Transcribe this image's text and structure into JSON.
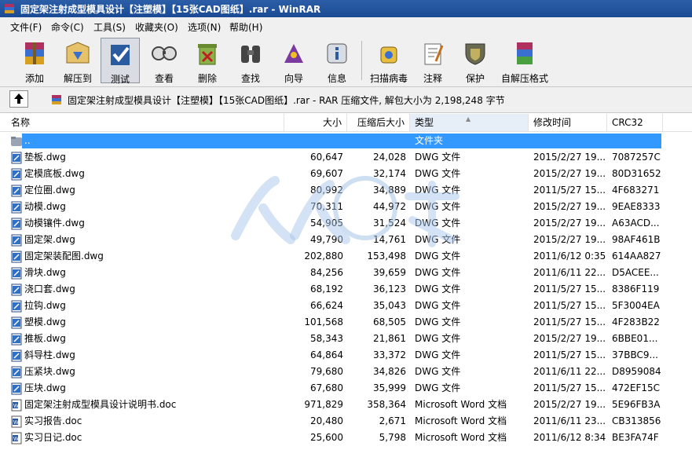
{
  "window": {
    "title": "固定架注射成型模具设计【注塑模】【15张CAD图纸】.rar - WinRAR"
  },
  "menu": [
    {
      "label": "文件(F)"
    },
    {
      "label": "命令(C)"
    },
    {
      "label": "工具(S)"
    },
    {
      "label": "收藏夹(O)"
    },
    {
      "label": "选项(N)"
    },
    {
      "label": "帮助(H)"
    }
  ],
  "toolbar": [
    {
      "label": "添加",
      "icon": "add-icon"
    },
    {
      "label": "解压到",
      "icon": "extract-icon"
    },
    {
      "label": "测试",
      "icon": "test-icon"
    },
    {
      "label": "查看",
      "icon": "view-icon"
    },
    {
      "label": "删除",
      "icon": "delete-icon"
    },
    {
      "label": "查找",
      "icon": "find-icon"
    },
    {
      "label": "向导",
      "icon": "wizard-icon"
    },
    {
      "label": "信息",
      "icon": "info-icon"
    },
    {
      "label": "扫描病毒",
      "icon": "virus-scan-icon"
    },
    {
      "label": "注释",
      "icon": "comment-icon"
    },
    {
      "label": "保护",
      "icon": "protect-icon"
    },
    {
      "label": "自解压格式",
      "icon": "sfx-icon"
    }
  ],
  "pathbar": {
    "text": "固定架注射成型模具设计【注塑模】【15张CAD图纸】.rar - RAR 压缩文件, 解包大小为 2,198,248 字节"
  },
  "columns": [
    {
      "label": "名称"
    },
    {
      "label": "大小"
    },
    {
      "label": "压缩后大小"
    },
    {
      "label": "类型"
    },
    {
      "label": "修改时间"
    },
    {
      "label": "CRC32"
    }
  ],
  "files": [
    {
      "name": "..",
      "size": "",
      "packed": "",
      "type": "文件夹",
      "modified": "",
      "crc": "",
      "kind": "folder"
    },
    {
      "name": "垫板.dwg",
      "size": "60,647",
      "packed": "24,028",
      "type": "DWG 文件",
      "modified": "2015/2/27 19...",
      "crc": "7087257C",
      "kind": "dwg"
    },
    {
      "name": "定模底板.dwg",
      "size": "69,607",
      "packed": "32,174",
      "type": "DWG 文件",
      "modified": "2015/2/27 19...",
      "crc": "80D31652",
      "kind": "dwg"
    },
    {
      "name": "定位圈.dwg",
      "size": "80,992",
      "packed": "34,889",
      "type": "DWG 文件",
      "modified": "2011/5/27 15...",
      "crc": "4F683271",
      "kind": "dwg"
    },
    {
      "name": "动模.dwg",
      "size": "70,311",
      "packed": "44,972",
      "type": "DWG 文件",
      "modified": "2015/2/27 19...",
      "crc": "9EAE8333",
      "kind": "dwg"
    },
    {
      "name": "动模镶件.dwg",
      "size": "54,905",
      "packed": "31,524",
      "type": "DWG 文件",
      "modified": "2015/2/27 19...",
      "crc": "A63ACD...",
      "kind": "dwg"
    },
    {
      "name": "固定架.dwg",
      "size": "49,790",
      "packed": "14,761",
      "type": "DWG 文件",
      "modified": "2015/2/27 19...",
      "crc": "98AF461B",
      "kind": "dwg"
    },
    {
      "name": "固定架装配图.dwg",
      "size": "202,880",
      "packed": "153,498",
      "type": "DWG 文件",
      "modified": "2011/6/12 0:35",
      "crc": "614AA827",
      "kind": "dwg"
    },
    {
      "name": "滑块.dwg",
      "size": "84,256",
      "packed": "39,659",
      "type": "DWG 文件",
      "modified": "2011/6/11 22...",
      "crc": "D5ACEE...",
      "kind": "dwg"
    },
    {
      "name": "浇口套.dwg",
      "size": "68,192",
      "packed": "36,123",
      "type": "DWG 文件",
      "modified": "2011/5/27 15...",
      "crc": "8386F119",
      "kind": "dwg"
    },
    {
      "name": "拉钩.dwg",
      "size": "66,624",
      "packed": "35,043",
      "type": "DWG 文件",
      "modified": "2011/5/27 15...",
      "crc": "5F3004EA",
      "kind": "dwg"
    },
    {
      "name": "塑模.dwg",
      "size": "101,568",
      "packed": "68,505",
      "type": "DWG 文件",
      "modified": "2011/5/27 15...",
      "crc": "4F283B22",
      "kind": "dwg"
    },
    {
      "name": "推板.dwg",
      "size": "58,343",
      "packed": "21,861",
      "type": "DWG 文件",
      "modified": "2015/2/27 19...",
      "crc": "6BBE01...",
      "kind": "dwg"
    },
    {
      "name": "斜导柱.dwg",
      "size": "64,864",
      "packed": "33,372",
      "type": "DWG 文件",
      "modified": "2011/5/27 15...",
      "crc": "37BBC9...",
      "kind": "dwg"
    },
    {
      "name": "压紧块.dwg",
      "size": "79,680",
      "packed": "34,826",
      "type": "DWG 文件",
      "modified": "2011/6/11 22...",
      "crc": "D8959084",
      "kind": "dwg"
    },
    {
      "name": "压块.dwg",
      "size": "67,680",
      "packed": "35,999",
      "type": "DWG 文件",
      "modified": "2011/5/27 15...",
      "crc": "472EF15C",
      "kind": "dwg"
    },
    {
      "name": "固定架注射成型模具设计说明书.doc",
      "size": "971,829",
      "packed": "358,364",
      "type": "Microsoft Word 文档",
      "modified": "2015/2/27 19...",
      "crc": "5E96FB3A",
      "kind": "doc"
    },
    {
      "name": "实习报告.doc",
      "size": "20,480",
      "packed": "2,671",
      "type": "Microsoft Word 文档",
      "modified": "2011/6/11 23...",
      "crc": "CB313856",
      "kind": "doc"
    },
    {
      "name": "实习日记.doc",
      "size": "25,600",
      "packed": "5,798",
      "type": "Microsoft Word 文档",
      "modified": "2011/6/12 8:34",
      "crc": "BE3FA74F",
      "kind": "doc"
    }
  ],
  "colors": {
    "selection": "#3399ff",
    "titlebar": "#2c5ea8",
    "dwg_icon": "#2f6fc4",
    "doc_icon": "#2b579a"
  }
}
